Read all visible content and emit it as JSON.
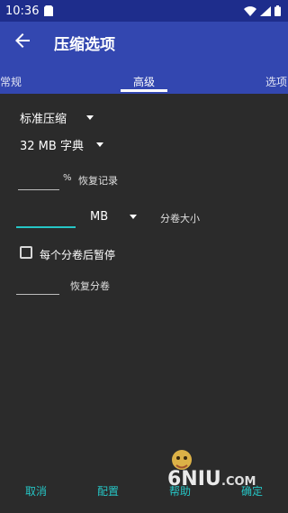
{
  "status_bar": {
    "time": "10:36"
  },
  "app_bar": {
    "title": "压缩选项"
  },
  "tabs": [
    {
      "label": "常规"
    },
    {
      "label": "高级"
    },
    {
      "label": "选项"
    }
  ],
  "advanced": {
    "compression_level": "标准压缩",
    "dictionary_size": "32 MB 字典",
    "recovery_record": {
      "value": "",
      "unit": "%",
      "label": "恢复记录"
    },
    "volume_size": {
      "value": "",
      "unit": "MB",
      "label": "分卷大小"
    },
    "pause_each_volume": {
      "label": "每个分卷后暂停",
      "checked": false
    },
    "recovery_volumes": {
      "value": "",
      "label": "恢复分卷"
    }
  },
  "buttons": {
    "cancel": "取消",
    "profiles": "配置",
    "help": "帮助",
    "ok": "确定"
  },
  "watermark": {
    "text": "6NIU.COM"
  },
  "colors": {
    "accent": "#26c6c6",
    "app_bar": "#3347b0",
    "status_bar": "#1e2d8c",
    "background": "#2b2b2b"
  }
}
